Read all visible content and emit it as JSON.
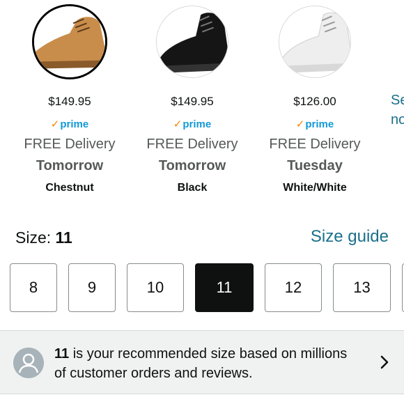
{
  "colors": [
    {
      "price": "$149.95",
      "prime": "prime",
      "delivery": "FREE Delivery",
      "when": "Tomorrow",
      "name": "Chestnut",
      "swatch": "#c98d4b",
      "selected": true
    },
    {
      "price": "$149.95",
      "prime": "prime",
      "delivery": "FREE Delivery",
      "when": "Tomorrow",
      "name": "Black",
      "swatch": "#151515",
      "selected": false
    },
    {
      "price": "$126.00",
      "prime": "prime",
      "delivery": "FREE Delivery",
      "when": "Tuesday",
      "name": "White/White",
      "swatch": "#f2f2f2",
      "selected": false
    }
  ],
  "see_more": {
    "line1": "Se",
    "line2": "no"
  },
  "size": {
    "label": "Size:",
    "value": "11",
    "guide": "Size guide"
  },
  "sizes": [
    "8",
    "9",
    "10",
    "11",
    "12",
    "13"
  ],
  "selected_size": "11",
  "recommendation": {
    "size": "11",
    "text": " is your recommended size based on millions of customer orders and reviews."
  },
  "theme": {
    "prime_blue": "#1399d6",
    "prime_check": "#f08804",
    "link": "#1a6f8b"
  }
}
